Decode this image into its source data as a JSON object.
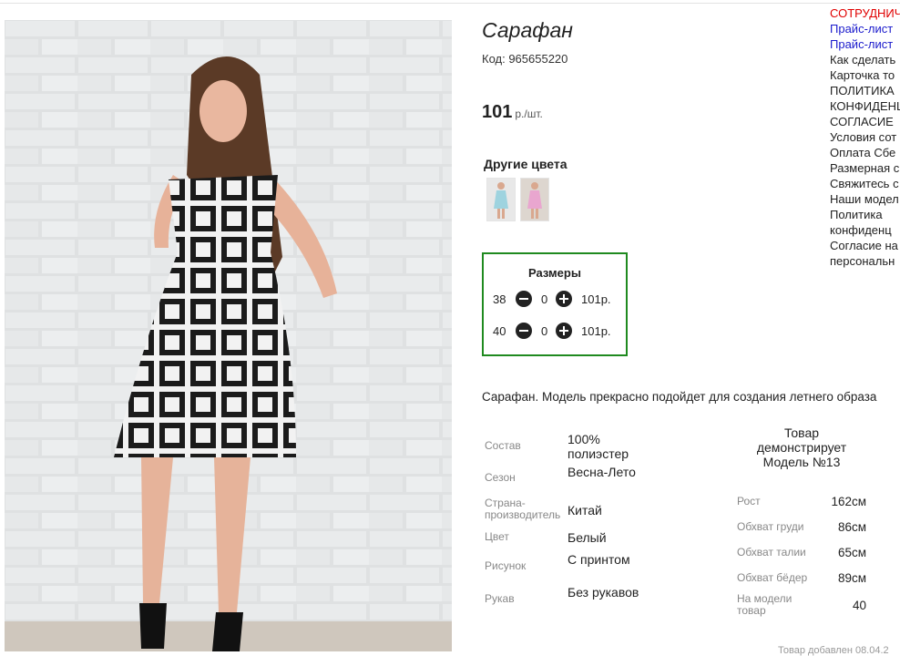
{
  "product": {
    "title": "Сарафан",
    "code": "Код: 965655220",
    "price": "101",
    "price_unit": "р./шт.",
    "other_colors_label": "Другие цвета",
    "other_colors": [
      {
        "name": "thumb-blue",
        "color": "#9ed3df"
      },
      {
        "name": "thumb-pink",
        "color": "#e9a6cf"
      }
    ]
  },
  "sizes": {
    "title": "Размеры",
    "rows": [
      {
        "size": "38",
        "qty": "0",
        "price": "101р."
      },
      {
        "size": "40",
        "qty": "0",
        "price": "101р."
      }
    ],
    "border_color": "#1f8a1f"
  },
  "description": "Сарафан. Модель прекрасно подойдет для создания летнего образа",
  "specs": [
    {
      "label": "Состав",
      "value": "100% полиэстер"
    },
    {
      "label": "Сезон",
      "value": "Весна-Лето"
    },
    {
      "label": "Страна-производитель",
      "value": "Китай"
    },
    {
      "label": "Цвет",
      "value": "Белый"
    },
    {
      "label": "Рисунок",
      "value": "С принтом"
    },
    {
      "label": "Рукав",
      "value": "Без рукавов"
    }
  ],
  "model": {
    "heading": "Товар демонстрирует Модель №13",
    "params": [
      {
        "label": "Рост",
        "value": "162см"
      },
      {
        "label": "Обхват груди",
        "value": "86см"
      },
      {
        "label": "Обхват талии",
        "value": "65см"
      },
      {
        "label": "Обхват бёдер",
        "value": "89см"
      },
      {
        "label": "На модели товар",
        "value": "40"
      }
    ]
  },
  "added_text": "Товар добавлен 08.04.2",
  "menu": [
    {
      "label": "СОТРУДНИЧ",
      "color": "red"
    },
    {
      "label": "Прайс-лист",
      "color": "blue"
    },
    {
      "label": "Прайс-лист",
      "color": "blue"
    },
    {
      "label": "Как сделать",
      "color": "dark"
    },
    {
      "label": "Карточка то",
      "color": "dark"
    },
    {
      "label": "ПОЛИТИКА",
      "color": "dark"
    },
    {
      "label": "КОНФИДЕНЦ",
      "color": "dark"
    },
    {
      "label": "СОГЛАСИЕ",
      "color": "dark"
    },
    {
      "label": "Условия сот",
      "color": "dark"
    },
    {
      "label": "Оплата Сбе",
      "color": "dark"
    },
    {
      "label": "Размерная с",
      "color": "dark"
    },
    {
      "label": "Свяжитесь с",
      "color": "dark"
    },
    {
      "label": "Наши модел",
      "color": "dark"
    },
    {
      "label": "Политика",
      "color": "dark"
    },
    {
      "label": "конфиденц",
      "color": "dark"
    },
    {
      "label": "Согласие на",
      "color": "dark"
    },
    {
      "label": "персональн",
      "color": "dark"
    }
  ]
}
